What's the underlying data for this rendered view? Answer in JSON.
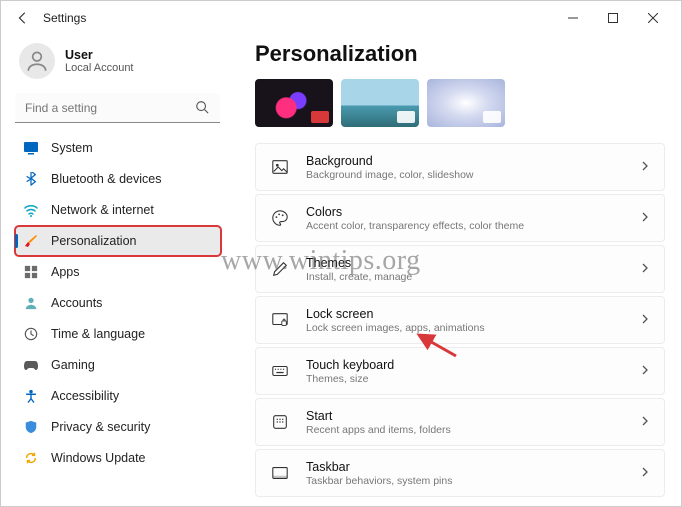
{
  "window": {
    "title": "Settings"
  },
  "user": {
    "name": "User",
    "subtitle": "Local Account"
  },
  "search": {
    "placeholder": "Find a setting"
  },
  "sidebar": {
    "items": [
      {
        "label": "System"
      },
      {
        "label": "Bluetooth & devices"
      },
      {
        "label": "Network & internet"
      },
      {
        "label": "Personalization"
      },
      {
        "label": "Apps"
      },
      {
        "label": "Accounts"
      },
      {
        "label": "Time & language"
      },
      {
        "label": "Gaming"
      },
      {
        "label": "Accessibility"
      },
      {
        "label": "Privacy & security"
      },
      {
        "label": "Windows Update"
      }
    ]
  },
  "page": {
    "title": "Personalization"
  },
  "cards": [
    {
      "title": "Background",
      "subtitle": "Background image, color, slideshow"
    },
    {
      "title": "Colors",
      "subtitle": "Accent color, transparency effects, color theme"
    },
    {
      "title": "Themes",
      "subtitle": "Install, create, manage"
    },
    {
      "title": "Lock screen",
      "subtitle": "Lock screen images, apps, animations"
    },
    {
      "title": "Touch keyboard",
      "subtitle": "Themes, size"
    },
    {
      "title": "Start",
      "subtitle": "Recent apps and items, folders"
    },
    {
      "title": "Taskbar",
      "subtitle": "Taskbar behaviors, system pins"
    }
  ],
  "watermark": "www.wintips.org"
}
